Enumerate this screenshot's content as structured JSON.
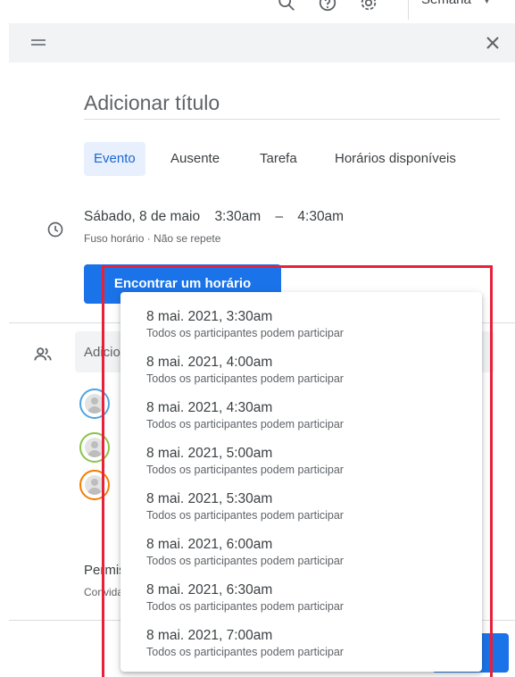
{
  "topbar": {
    "view_label": "Semana",
    "icons": [
      "search-icon",
      "help-icon",
      "settings-icon"
    ]
  },
  "dialog": {
    "title_placeholder": "Adicionar título",
    "tabs": [
      {
        "label": "Evento",
        "active": true
      },
      {
        "label": "Ausente",
        "active": false
      },
      {
        "label": "Tarefa",
        "active": false
      },
      {
        "label": "Horários disponíveis",
        "active": false
      }
    ],
    "datetime": {
      "date": "Sábado, 8 de maio",
      "start": "3:30am",
      "dash": "–",
      "end": "4:30am",
      "subline": "Fuso horário · Não se repete"
    },
    "find_time_label": "Encontrar um horário",
    "guests": {
      "placeholder": "Adicionar convidados",
      "avatar_colors": [
        "#4fa3e0",
        "#8bc34a",
        "#f57c00"
      ]
    },
    "permissions": {
      "title": "Permissões dos convidados",
      "subtitle": "Convidar outras pessoas"
    }
  },
  "time_dropdown": {
    "highlight_color": "#e8213a",
    "options": [
      {
        "time": "8 mai. 2021, 3:30am",
        "note": "Todos os participantes podem participar"
      },
      {
        "time": "8 mai. 2021, 4:00am",
        "note": "Todos os participantes podem participar"
      },
      {
        "time": "8 mai. 2021, 4:30am",
        "note": "Todos os participantes podem participar"
      },
      {
        "time": "8 mai. 2021, 5:00am",
        "note": "Todos os participantes podem participar"
      },
      {
        "time": "8 mai. 2021, 5:30am",
        "note": "Todos os participantes podem participar"
      },
      {
        "time": "8 mai. 2021, 6:00am",
        "note": "Todos os participantes podem participar"
      },
      {
        "time": "8 mai. 2021, 6:30am",
        "note": "Todos os participantes podem participar"
      },
      {
        "time": "8 mai. 2021, 7:00am",
        "note": "Todos os participantes podem participar"
      }
    ]
  }
}
